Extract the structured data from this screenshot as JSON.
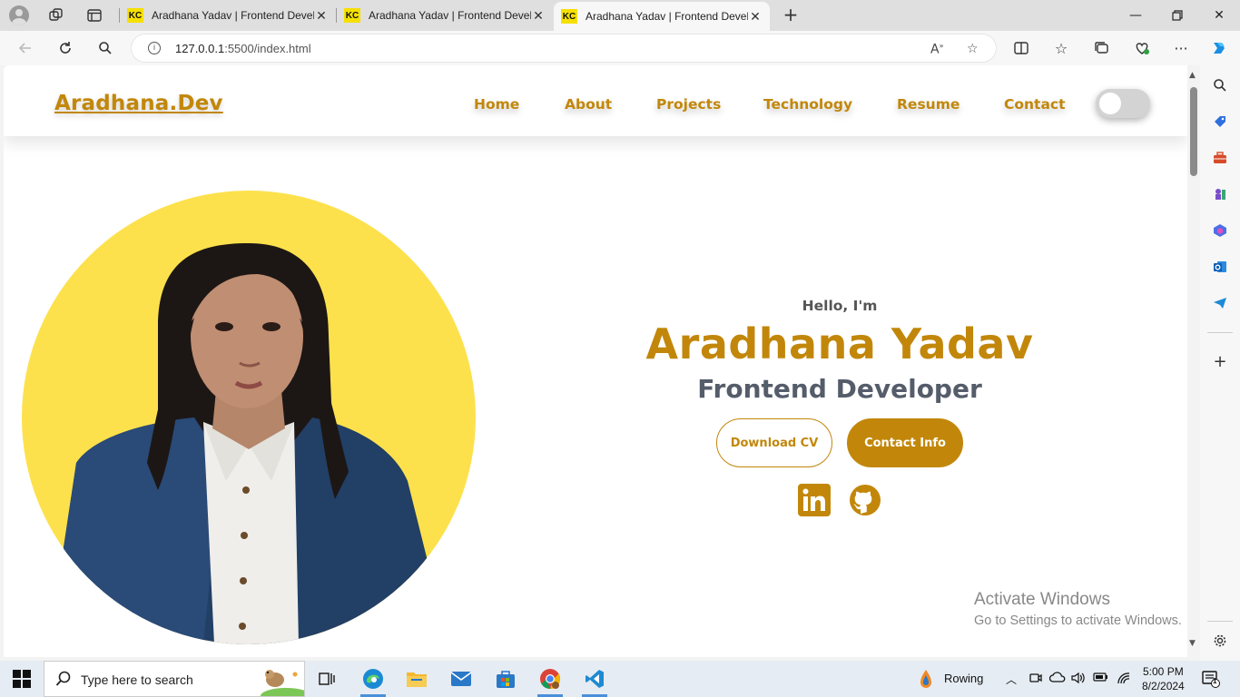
{
  "browser": {
    "tabs": [
      {
        "favicon": "KC",
        "title": "Aradhana Yadav | Frontend Developer",
        "active": false
      },
      {
        "favicon": "KC",
        "title": "Aradhana Yadav | Frontend Developer",
        "active": false
      },
      {
        "favicon": "KC",
        "title": "Aradhana Yadav | Frontend Developer",
        "active": true
      }
    ],
    "url_host": "127.0.0.1",
    "url_path": ":5500/index.html"
  },
  "site": {
    "logo": "Aradhana.Dev",
    "nav": [
      "Home",
      "About",
      "Projects",
      "Technology",
      "Resume",
      "Contact"
    ],
    "theme_toggle": "off"
  },
  "hero": {
    "greeting": "Hello, I'm",
    "name": "Aradhana Yadav",
    "role": "Frontend Developer",
    "download_cv_label": "Download CV",
    "contact_info_label": "Contact Info",
    "socials": [
      "linkedin-icon",
      "github-icon"
    ]
  },
  "watermark": {
    "line1": "Activate Windows",
    "line2": "Go to Settings to activate Windows."
  },
  "taskbar": {
    "search_placeholder": "Type here to search",
    "weather": "Rowing",
    "time": "5:00 PM",
    "date": "8/2/2024",
    "notification_count": "1"
  },
  "colors": {
    "accent": "#c2870a",
    "photo_bg": "#fde14c",
    "role_text": "#555c6a"
  }
}
